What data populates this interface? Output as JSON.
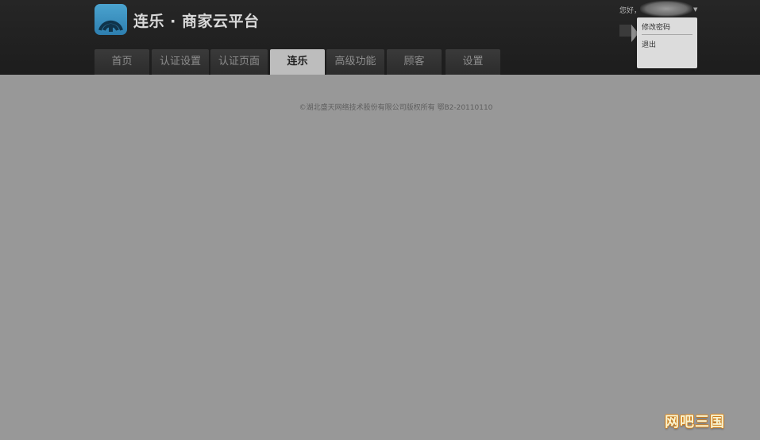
{
  "header": {
    "brand_title": "连乐 · 商家云平台",
    "logo_icon": "wifi-signal-icon",
    "accent_color": "#3b8fc0"
  },
  "nav": {
    "tabs": [
      {
        "label": "首页",
        "active": false
      },
      {
        "label": "认证设置",
        "active": false
      },
      {
        "label": "认证页面",
        "active": false
      },
      {
        "label": "连乐",
        "active": true
      },
      {
        "label": "高级功能",
        "active": false
      },
      {
        "label": "顾客",
        "active": false
      },
      {
        "label": "设置",
        "active": false
      }
    ]
  },
  "user": {
    "greeting": "您好，",
    "menu": {
      "change_password": "修改密码",
      "logout": "退出"
    }
  },
  "footer": {
    "copyright": "©湖北盛天网络技术股份有限公司版权所有 鄂B2-20110110"
  },
  "watermark": {
    "text": "网吧三国"
  }
}
